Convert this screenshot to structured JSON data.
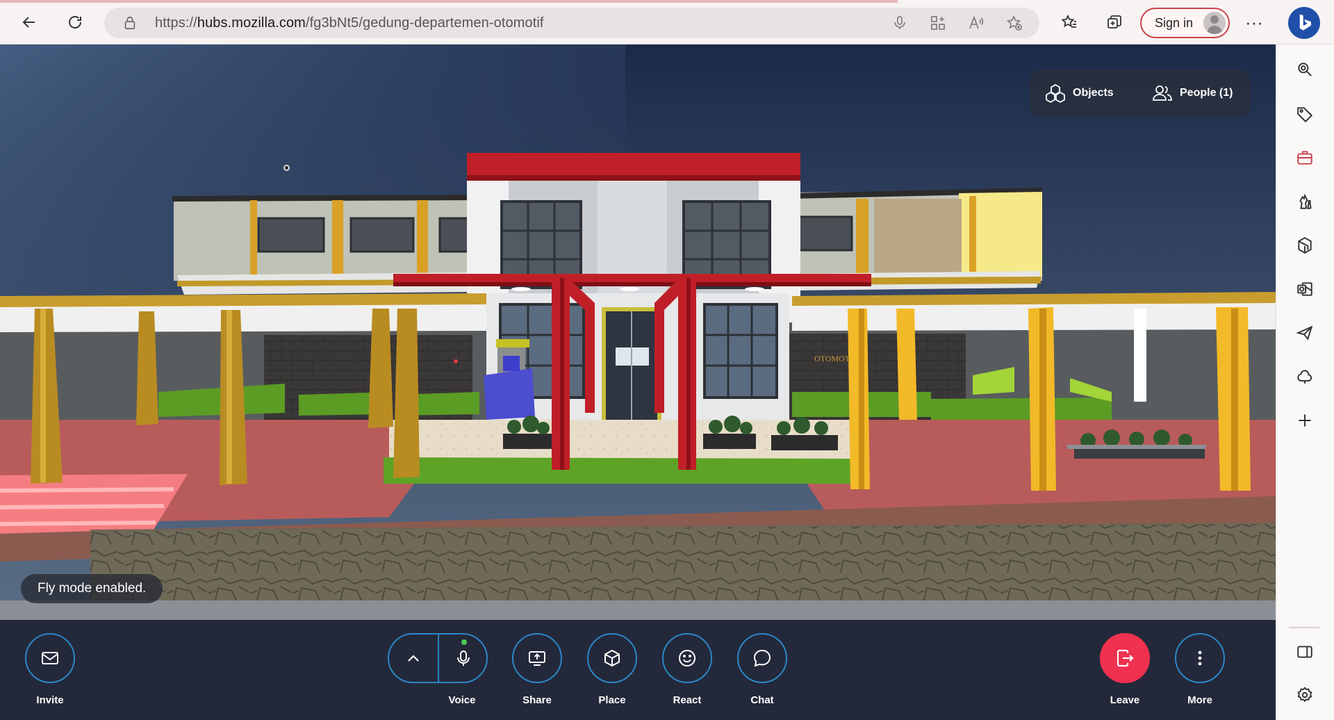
{
  "browser": {
    "url_prefix": "https://",
    "url_host": "hubs.mozilla.com",
    "url_path": "/fg3bNt5/gedung-departemen-otomotif",
    "sign_in_label": "Sign in",
    "more_label": "···"
  },
  "scene": {
    "tabs": {
      "objects_label": "Objects",
      "people_label": "People (1)"
    },
    "toast": "Fly mode enabled.",
    "building_sign": "OTOMOTIF",
    "colors": {
      "sky_top": "#1c2a4a",
      "sky_bottom": "#5a6e86",
      "accent_red": "#c01f28",
      "pillar_yellow": "#f2b928",
      "floor_red": "#b85b5b"
    }
  },
  "toolbar": {
    "invite": "Invite",
    "voice": "Voice",
    "share": "Share",
    "place": "Place",
    "react": "React",
    "chat": "Chat",
    "leave": "Leave",
    "more": "More",
    "mic_active": true,
    "accent_color": "#2c87c7",
    "leave_color": "#f0314f"
  },
  "sidebar": {
    "icons": [
      "search-icon",
      "tag-icon",
      "briefcase-icon",
      "chess-icon",
      "office-icon",
      "outlook-icon",
      "send-icon",
      "cloud-icon",
      "add-icon",
      "split-screen-icon",
      "settings-icon"
    ]
  }
}
